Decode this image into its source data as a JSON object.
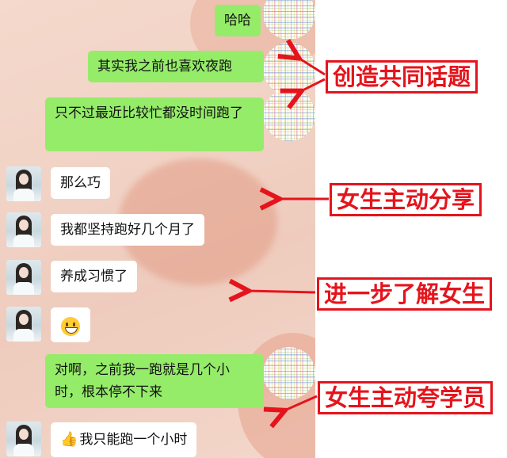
{
  "messages": [
    {
      "side": "right",
      "text": "哈哈"
    },
    {
      "side": "right",
      "text": "其实我之前也喜欢夜跑"
    },
    {
      "side": "right",
      "text": "只不过最近比较忙都没时间跑了"
    },
    {
      "side": "left",
      "text": "那么巧"
    },
    {
      "side": "left",
      "text": "我都坚持跑好几个月了"
    },
    {
      "side": "left",
      "text": "养成习惯了"
    },
    {
      "side": "left",
      "emoji": "grinning-face-emoji"
    },
    {
      "side": "right",
      "text": "对啊，之前我一跑就是几个小时，根本停不下来"
    },
    {
      "side": "left",
      "text": "我只能跑一个小时",
      "prefix_icon": "thumbs-up-icon"
    }
  ],
  "annotations": [
    {
      "text": "创造共同话题"
    },
    {
      "text": "女生主动分享"
    },
    {
      "text": "进一步了解女生"
    },
    {
      "text": "女生主动夸学员"
    }
  ],
  "colors": {
    "annotation": "#e5141c",
    "sent_bubble": "#95ec69",
    "received_bubble": "#ffffff"
  }
}
